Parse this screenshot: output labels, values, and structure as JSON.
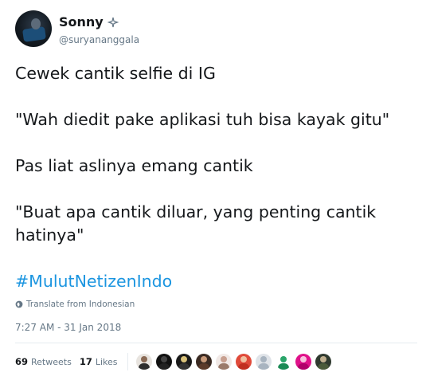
{
  "author": {
    "name": "Sonny",
    "badge_icon": "sparkle-icon",
    "handle": "@suryananggala"
  },
  "tweet": {
    "lines": [
      "Cewek cantik selfie di IG",
      "\"Wah diedit pake aplikasi tuh bisa kayak gitu\"",
      "Pas liat aslinya emang cantik",
      "\"Buat apa cantik diluar, yang penting cantik hatinya\""
    ],
    "hashtag": "#MulutNetizenIndo"
  },
  "translate": {
    "icon": "globe-icon",
    "label": "Translate from Indonesian"
  },
  "timestamp": "7:27 AM - 31 Jan 2018",
  "stats": {
    "retweets_count": "69",
    "retweets_label": "Retweets",
    "likes_count": "17",
    "likes_label": "Likes"
  },
  "colors": {
    "text": "#14171a",
    "secondary": "#657786",
    "link": "#1b95e0",
    "divider": "#e6ecf0"
  },
  "likers": [
    {
      "bg": "#e8e4df",
      "head": "#8a6a55",
      "body": "#2d2d2d"
    },
    {
      "bg": "#111111",
      "head": "#444444",
      "body": "#222222"
    },
    {
      "bg": "#1a1a1a",
      "head": "#d9c27a",
      "body": "#333333"
    },
    {
      "bg": "#3a2a22",
      "head": "#c89a7a",
      "body": "#5a3a2a"
    },
    {
      "bg": "#f1e9e6",
      "head": "#c8a090",
      "body": "#9a7a6a"
    },
    {
      "bg": "#e04a3a",
      "head": "#f0c0a0",
      "body": "#c03020"
    },
    {
      "bg": "#dfe3e8",
      "head": "#a8b4c0",
      "body": "#a8b4c0"
    },
    {
      "bg": "#ffffff",
      "head": "#2aa56a",
      "body": "#1b8a55"
    },
    {
      "bg": "#e0118a",
      "head": "#f7c2de",
      "body": "#b0006a"
    },
    {
      "bg": "#2f3a2f",
      "head": "#c0b090",
      "body": "#4a5a3a"
    }
  ]
}
